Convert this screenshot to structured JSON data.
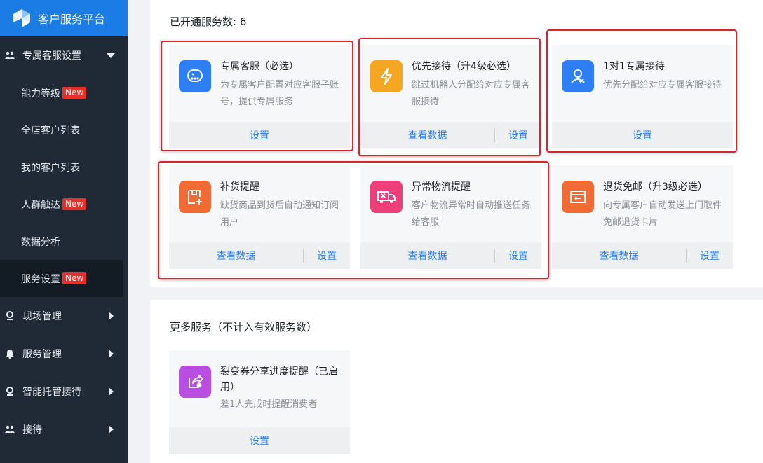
{
  "app": {
    "title": "客户服务平台"
  },
  "sidebar": {
    "groups": [
      {
        "label": "专属客服设置"
      },
      {
        "label": "现场管理"
      },
      {
        "label": "服务管理"
      },
      {
        "label": "智能托管接待"
      },
      {
        "label": "接待"
      }
    ],
    "items": [
      {
        "label": "能力等级",
        "badge": "New"
      },
      {
        "label": "全店客户列表"
      },
      {
        "label": "我的客户列表"
      },
      {
        "label": "人群触达",
        "badge": "New"
      },
      {
        "label": "数据分析"
      },
      {
        "label": "服务设置",
        "badge": "New"
      }
    ]
  },
  "services": {
    "count_label": "已开通服务数: 6",
    "cards": [
      {
        "title": "专属客服（必选）",
        "desc": "为专属客户配置对应客服子账号，提供专属服务",
        "icon": "robot-face-icon",
        "color": "#2e7ef5",
        "actions": [
          "设置"
        ]
      },
      {
        "title": "优先接待（升4级必选）",
        "desc": "跳过机器人分配给对应专属客服接待",
        "icon": "lightning-icon",
        "color": "#f5a623",
        "actions": [
          "查看数据",
          "设置"
        ]
      },
      {
        "title": "1对1专属接待",
        "desc": "优先分配给对应专属客服接待",
        "icon": "user-check-icon",
        "color": "#2e7ef5",
        "actions": [
          "设置"
        ]
      },
      {
        "title": "补货提醒",
        "desc": "缺货商品到货后自动通知订阅用户",
        "icon": "restock-icon",
        "color": "#f26b35",
        "actions": [
          "查看数据",
          "设置"
        ]
      },
      {
        "title": "异常物流提醒",
        "desc": "客户物流异常时自动推送任务给客服",
        "icon": "truck-alert-icon",
        "color": "#ef3f7a",
        "actions": [
          "查看数据",
          "设置"
        ]
      },
      {
        "title": "退货免邮（升3级必选）",
        "desc": "向专属客户自动发送上门取件免邮退货卡片",
        "icon": "return-ticket-icon",
        "color": "#f26b35",
        "actions": [
          "查看数据",
          "设置"
        ]
      }
    ]
  },
  "more": {
    "title": "更多服务（不计入有效服务数）",
    "cards": [
      {
        "title": "裂变券分享进度提醒（已启用）",
        "desc": "差1人完成时提醒消费者",
        "icon": "share-coupon-icon",
        "color": "#b84fe0",
        "actions": [
          "设置"
        ]
      }
    ]
  }
}
